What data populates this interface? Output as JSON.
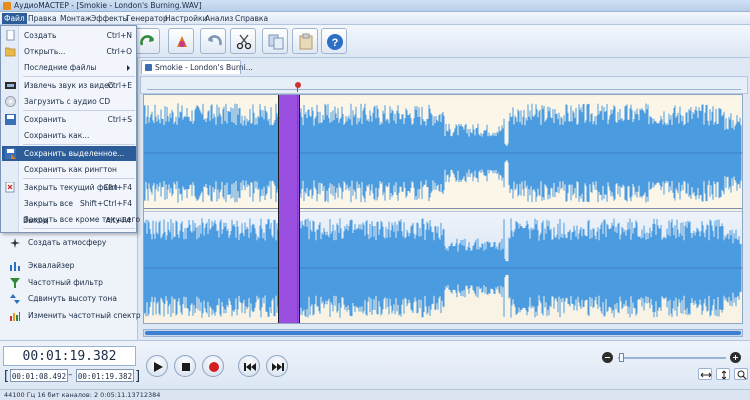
{
  "window": {
    "title": "АудиоМАСТЕР - [Smokie - London's Burning.WAV]"
  },
  "menubar": {
    "items": [
      "Файл",
      "Правка",
      "Монтаж",
      "Эффекты",
      "Генератор",
      "Настройки",
      "Анализ",
      "Справка"
    ]
  },
  "toolbar": {
    "buttons": [
      "redo-icon",
      "effects-icon",
      "undo-icon",
      "cut-icon",
      "copy-icon",
      "paste-icon",
      "help-icon"
    ]
  },
  "file_menu": {
    "items": [
      {
        "label": "Создать",
        "shortcut": "Ctrl+N",
        "icon": "new-file-icon"
      },
      {
        "label": "Открыть...",
        "shortcut": "Ctrl+O",
        "icon": "open-folder-icon"
      },
      {
        "label": "Последние файлы",
        "shortcut": "",
        "icon": ""
      },
      {
        "label": "Извлечь звук из видео",
        "shortcut": "Ctrl+E",
        "icon": "video-icon"
      },
      {
        "label": "Загрузить с аудио CD",
        "shortcut": "",
        "icon": "cd-icon"
      },
      {
        "label": "Сохранить",
        "shortcut": "Ctrl+S",
        "icon": "save-icon"
      },
      {
        "label": "Сохранить как...",
        "shortcut": "",
        "icon": ""
      },
      {
        "label": "Сохранить выделенное...",
        "shortcut": "",
        "icon": "save-selection-icon"
      },
      {
        "label": "Сохранить как рингтон",
        "shortcut": "",
        "icon": ""
      },
      {
        "label": "Закрыть текущий файл",
        "shortcut": "Ctrl+F4",
        "icon": "close-file-icon"
      },
      {
        "label": "Закрыть все",
        "shortcut": "Shift+Ctrl+F4",
        "icon": ""
      },
      {
        "label": "Закрыть все кроме текущего",
        "shortcut": "",
        "icon": ""
      },
      {
        "label": "Выход",
        "shortcut": "Alt+F4",
        "icon": ""
      }
    ],
    "highlighted_index": 7
  },
  "effects_panel": {
    "items": [
      {
        "label": "Создать атмосферу",
        "icon": "atmosphere-icon"
      },
      {
        "label": "Эквалайзер",
        "icon": "equalizer-icon"
      },
      {
        "label": "Частотный фильтр",
        "icon": "filter-icon"
      },
      {
        "label": "Сдвинуть высоту тона",
        "icon": "pitch-icon"
      },
      {
        "label": "Изменить частотный спектр",
        "icon": "spectrum-icon"
      }
    ]
  },
  "tabs": [
    {
      "label": "Smokie - London's Burni..."
    }
  ],
  "waveform": {
    "color": "#4a9be0",
    "selection_color": "#9a4fe0",
    "background": "#fbf6e8"
  },
  "player": {
    "current_time": "00:01:19.382",
    "selection_start": "00:01:08.492",
    "selection_end": "00:01:19.382",
    "range_separator": "–",
    "zoom_level": 0.01
  },
  "statusbar": {
    "text": "44100 Гц  16 бит  каналов: 2   0:05:11.13712384"
  },
  "colors": {
    "accent": "#2c5d98",
    "playhead": "#d0312d"
  }
}
